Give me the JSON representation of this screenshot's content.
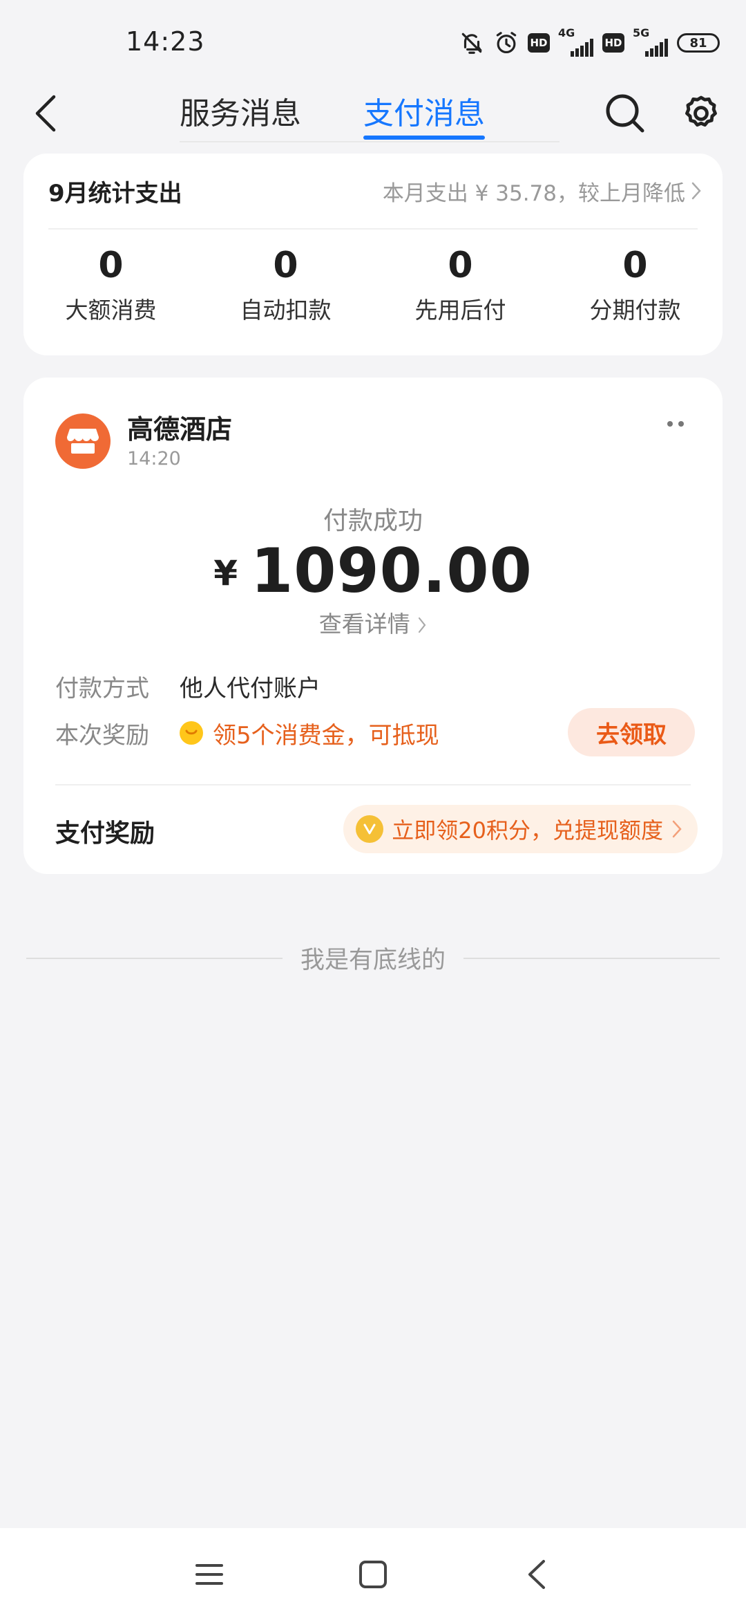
{
  "status_bar": {
    "time": "14:23",
    "icons": [
      "bell-off-icon",
      "alarm-icon",
      "hd-badge",
      "signal-4g-icon",
      "hd-badge",
      "signal-5g-icon",
      "battery-icon"
    ],
    "hd": "HD",
    "net1": "4G",
    "net2": "5G",
    "battery": "81"
  },
  "header": {
    "tabs": [
      {
        "label": "服务消息",
        "active": false
      },
      {
        "label": "支付消息",
        "active": true
      }
    ],
    "accent_color": "#1677ff"
  },
  "stats": {
    "title": "9月统计支出",
    "summary": "本月支出 ¥ 35.78，较上月降低",
    "items": [
      {
        "value": "0",
        "label": "大额消费"
      },
      {
        "value": "0",
        "label": "自动扣款"
      },
      {
        "value": "0",
        "label": "先用后付"
      },
      {
        "value": "0",
        "label": "分期付款"
      }
    ]
  },
  "payment": {
    "merchant_name": "高德酒店",
    "merchant_time": "14:20",
    "status": "付款成功",
    "currency": "¥",
    "amount": "1090.00",
    "detail_link": "查看详情",
    "method_label": "付款方式",
    "method_value": "他人代付账户",
    "reward_label": "本次奖励",
    "reward_text": "领5个消费金，可抵现",
    "claim_button": "去领取",
    "bonus_label": "支付奖励",
    "bonus_text": "立即领20积分，兑提现额度",
    "accent_color": "#e6601c"
  },
  "footer": {
    "bottom_text": "我是有底线的"
  }
}
